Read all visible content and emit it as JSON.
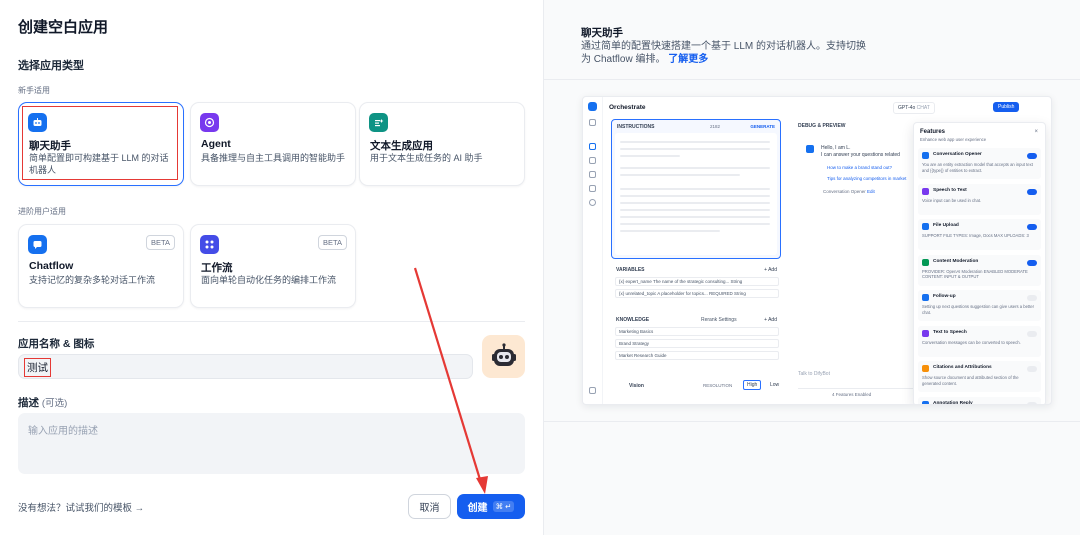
{
  "page": {
    "title": "创建空白应用"
  },
  "app_type": {
    "heading": "选择应用类型",
    "beginner_label": "新手适用",
    "advanced_label": "进阶用户适用",
    "beginner_cards": [
      {
        "title": "聊天助手",
        "desc": "简单配置即可构建基于 LLM 的对话机器人",
        "icon": "chat-bot-icon",
        "color": "#1570ef",
        "selected": true
      },
      {
        "title": "Agent",
        "desc": "具备推理与自主工具调用的智能助手",
        "icon": "agent-icon",
        "color": "#7839ee"
      },
      {
        "title": "文本生成应用",
        "desc": "用于文本生成任务的 AI 助手",
        "icon": "text-generator-icon",
        "color": "#0e9384"
      }
    ],
    "advanced_cards": [
      {
        "title": "Chatflow",
        "desc": "支持记忆的复杂多轮对话工作流",
        "badge": "BETA",
        "icon": "chatflow-icon",
        "color": "#1570ef"
      },
      {
        "title": "工作流",
        "desc": "面向单轮自动化任务的编排工作流",
        "badge": "BETA",
        "icon": "workflow-icon",
        "color": "#444ce7"
      }
    ]
  },
  "form": {
    "name_label": "应用名称 & 图标",
    "name_value": "测试",
    "desc_label": "描述",
    "desc_optional": "(可选)",
    "desc_placeholder": "输入应用的描述"
  },
  "footer": {
    "template_link": "没有想法？试试我们的模板 →",
    "cancel": "取消",
    "create": "创建",
    "create_shortcut": "⌘ ↵"
  },
  "preview_info": {
    "title": "聊天助手",
    "desc": "通过简单的配置快速搭建一个基于 LLM 的对话机器人。支持切换为 Chatflow 编排。",
    "link": "了解更多"
  },
  "preview": {
    "header": "Orchestrate",
    "model": "GPT-4o",
    "model_tag": "CHAT",
    "publish": "Publish",
    "instructions": "INSTRUCTIONS",
    "instructions_count": "2182",
    "generate": "GENERATE",
    "variables": "VARIABLES",
    "add": "+ Add",
    "var_rows": [
      "{x} expert_name   The name of the strategic consulting...   String",
      "{x} unrelated_topic   A placeholder for topics...   REQUIRED   String"
    ],
    "knowledge": "KNOWLEDGE",
    "retrieval": "Rerank Settings",
    "kb_rows": [
      "Marketing Basics",
      "Brand Strategy",
      "Market Research Guide"
    ],
    "vision": "Vision",
    "resolution": "RESOLUTION",
    "res_high": "High",
    "res_low": "Low",
    "debug": "DEBUG & PREVIEW",
    "chat_greeting": "Hello, I am L.",
    "chat_line": "I can answer your questions related",
    "suggestion_1": "How to make a brand stand out?",
    "suggestion_2": "Tips for analyzing competitors in market",
    "opener": "Conversation Opener",
    "edit": "Edit",
    "talk_placeholder": "Talk to DifyBot",
    "features_enabled": "4 Features Enabled",
    "features_title": "Features",
    "features_sub": "Enhance web app user experience",
    "features": [
      {
        "name": "Conversation Opener",
        "desc": "You are an entity extraction model that accepts an input text and {{type}} of entities to extract.",
        "color": "#1570ef",
        "on": true
      },
      {
        "name": "Speech to Text",
        "desc": "Voice input can be used in chat.",
        "color": "#7839ee",
        "on": true
      },
      {
        "name": "File Upload",
        "desc": "SUPPORT FILE TYPES: Image, Docs   MAX UPLOADS: 3",
        "color": "#1570ef",
        "on": true
      },
      {
        "name": "Content Moderation",
        "desc": "PROVIDER: OpenAI Moderation   ENABLED MODERATE CONTENT: INPUT & OUTPUT",
        "color": "#039855",
        "on": true
      },
      {
        "name": "Follow-up",
        "desc": "Setting up next questions suggestion can give users a better chat.",
        "color": "#1570ef",
        "on": false
      },
      {
        "name": "Text to Speech",
        "desc": "Conversation messages can be converted to speech.",
        "color": "#7839ee",
        "on": false
      },
      {
        "name": "Citations and Attributions",
        "desc": "Show source document and attributed section of the generated content.",
        "color": "#f79009",
        "on": false
      },
      {
        "name": "Annotation Reply",
        "desc": "",
        "color": "#1570ef",
        "on": false
      }
    ]
  },
  "colors": {
    "primary": "#155eef",
    "highlight": "#e53935",
    "border": "#eaecf0"
  }
}
